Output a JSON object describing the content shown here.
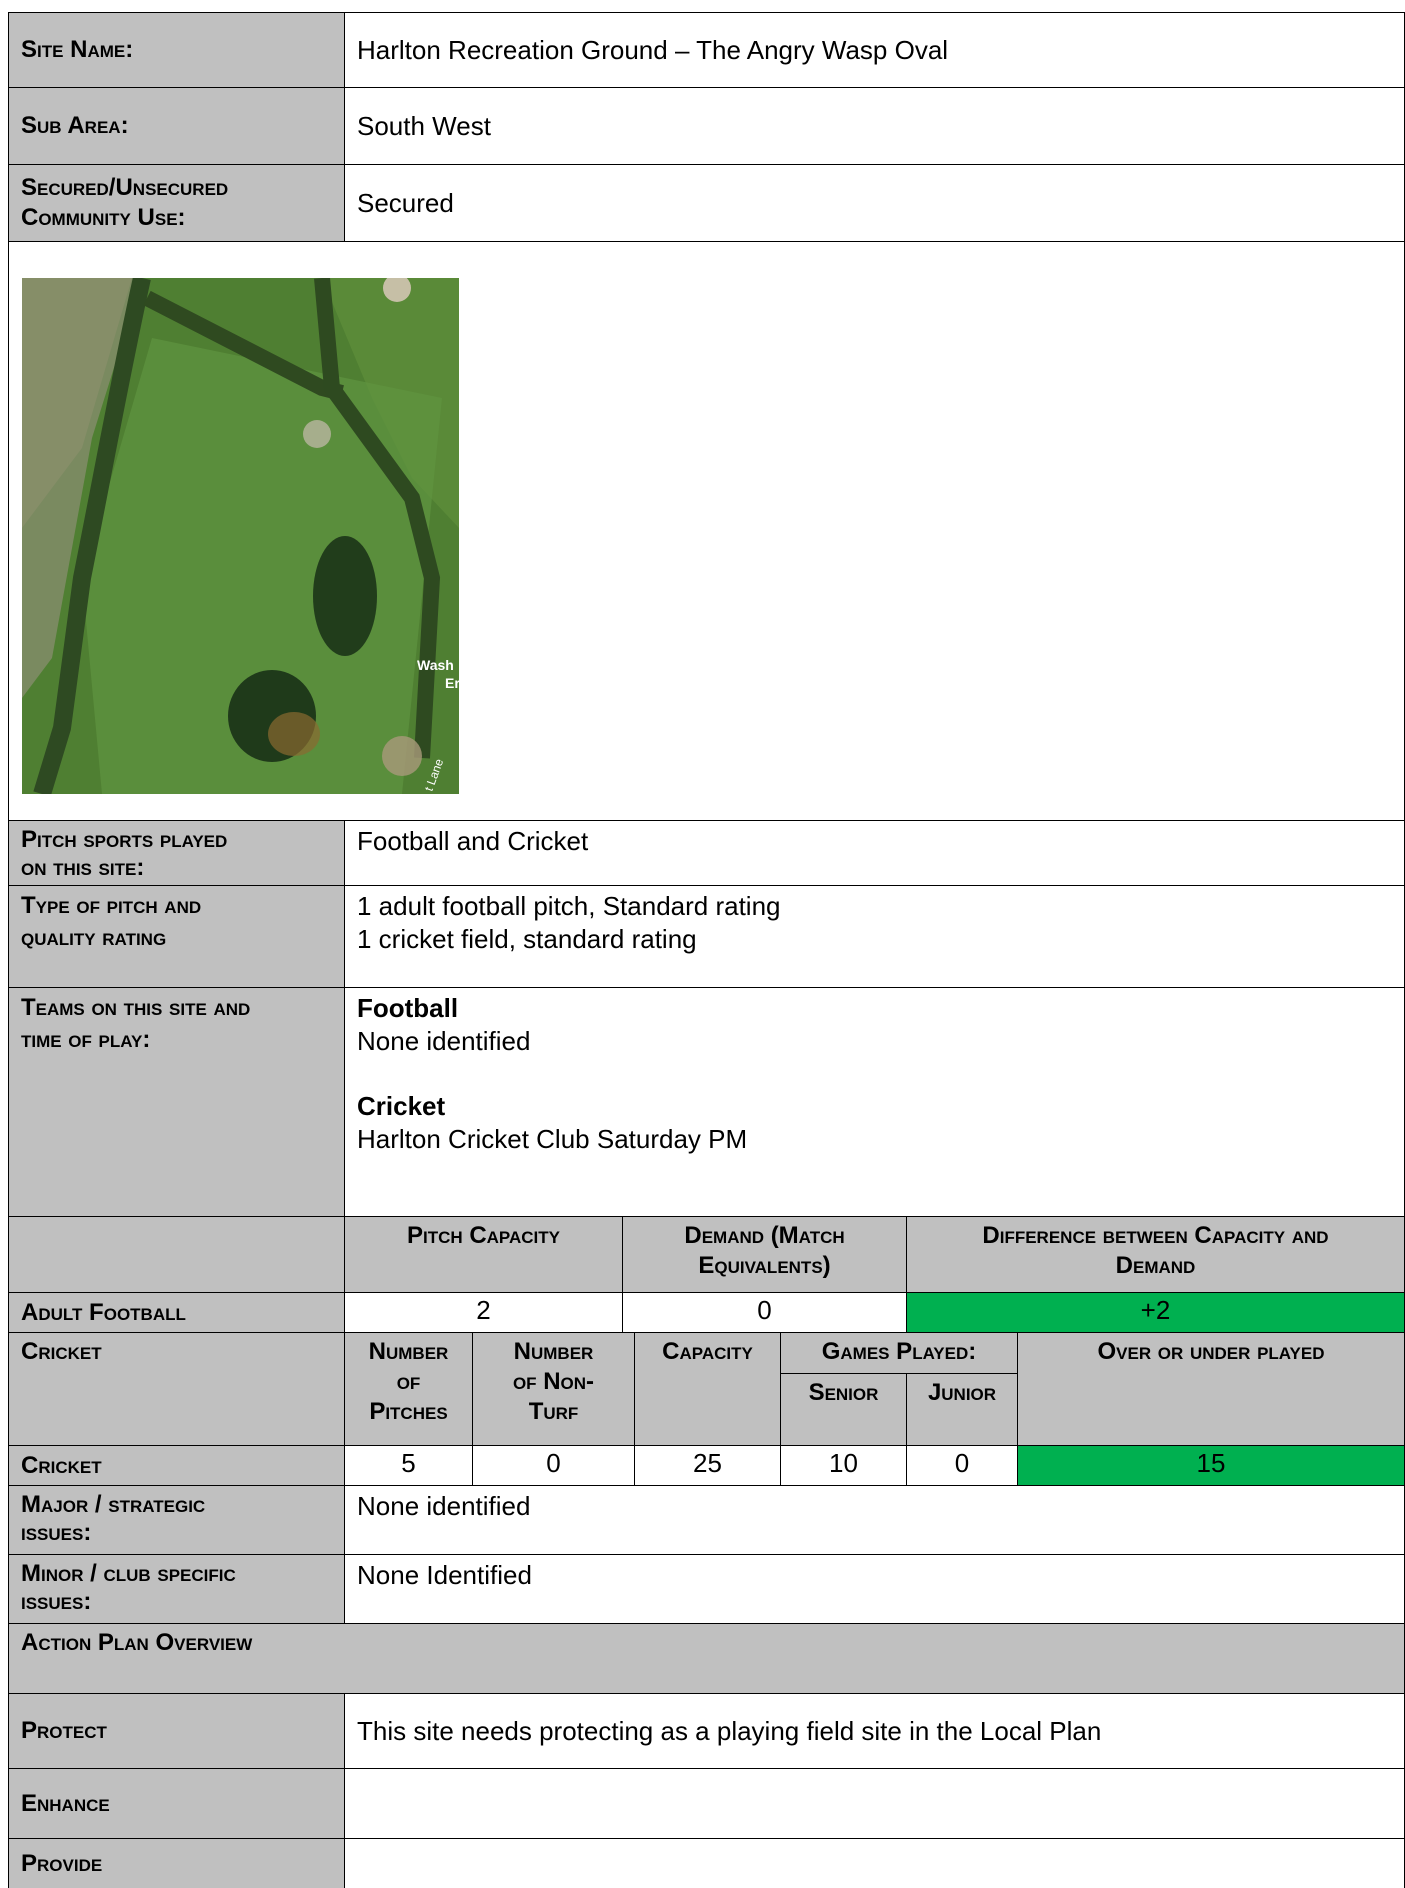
{
  "header": {
    "site_name_label": "Site Name:",
    "site_name": "Harlton Recreation Ground – The Angry Wasp Oval",
    "sub_area_label": "Sub Area:",
    "sub_area": "South West",
    "secured_label_1": "Secured/Unsecured",
    "secured_label_2": "Community Use:",
    "secured": "Secured"
  },
  "photo": {
    "map_label_1": "Wash",
    "map_label_2": "Er",
    "road_label": "t Lane"
  },
  "details": {
    "pitch_sports_label_1": "Pitch sports played",
    "pitch_sports_label_2": "on this site:",
    "pitch_sports": "Football and Cricket",
    "type_label_1": "Type of pitch and",
    "type_label_2": "quality rating",
    "type_line_1": "1 adult football pitch, Standard rating",
    "type_line_2": "1 cricket field, standard rating",
    "teams_label_1": "Teams on this site and",
    "teams_label_2": "time of play:",
    "teams_football_heading": "Football",
    "teams_football": "None identified",
    "teams_cricket_heading": "Cricket",
    "teams_cricket": "Harlton Cricket Club Saturday PM"
  },
  "football_table": {
    "col_capacity": "Pitch Capacity",
    "col_demand_1": "Demand (Match",
    "col_demand_2": "Equivalents)",
    "col_diff_1": "Difference between Capacity and",
    "col_diff_2": "Demand",
    "row_label": "Adult Football",
    "capacity": "2",
    "demand": "0",
    "difference": "+2"
  },
  "cricket_table": {
    "row_label": "Cricket",
    "col_pitches_1": "Number",
    "col_pitches_2": "of",
    "col_pitches_3": "Pitches",
    "col_nonturf_1": "Number",
    "col_nonturf_2": "of Non-",
    "col_nonturf_3": "Turf",
    "col_capacity": "Capacity",
    "col_games": "Games Played:",
    "col_senior": "Senior",
    "col_junior": "Junior",
    "col_over": "Over or under played",
    "data_label": "Cricket",
    "pitches": "5",
    "nonturf": "0",
    "capacity": "25",
    "senior": "10",
    "junior": "0",
    "over": "15"
  },
  "issues": {
    "major_label_1": "Major / strategic",
    "major_label_2": "issues:",
    "major": "None identified",
    "minor_label_1": "Minor / club specific",
    "minor_label_2": "issues:",
    "minor": "None Identified"
  },
  "action_plan": {
    "heading": "Action Plan Overview",
    "protect_label": "Protect",
    "protect": "This site needs protecting as a playing field site in the Local Plan",
    "enhance_label": "Enhance",
    "enhance": "",
    "provide_label": "Provide",
    "provide": ""
  },
  "colors": {
    "label_bg": "#c0c0c0",
    "positive_bg": "#00b050"
  }
}
